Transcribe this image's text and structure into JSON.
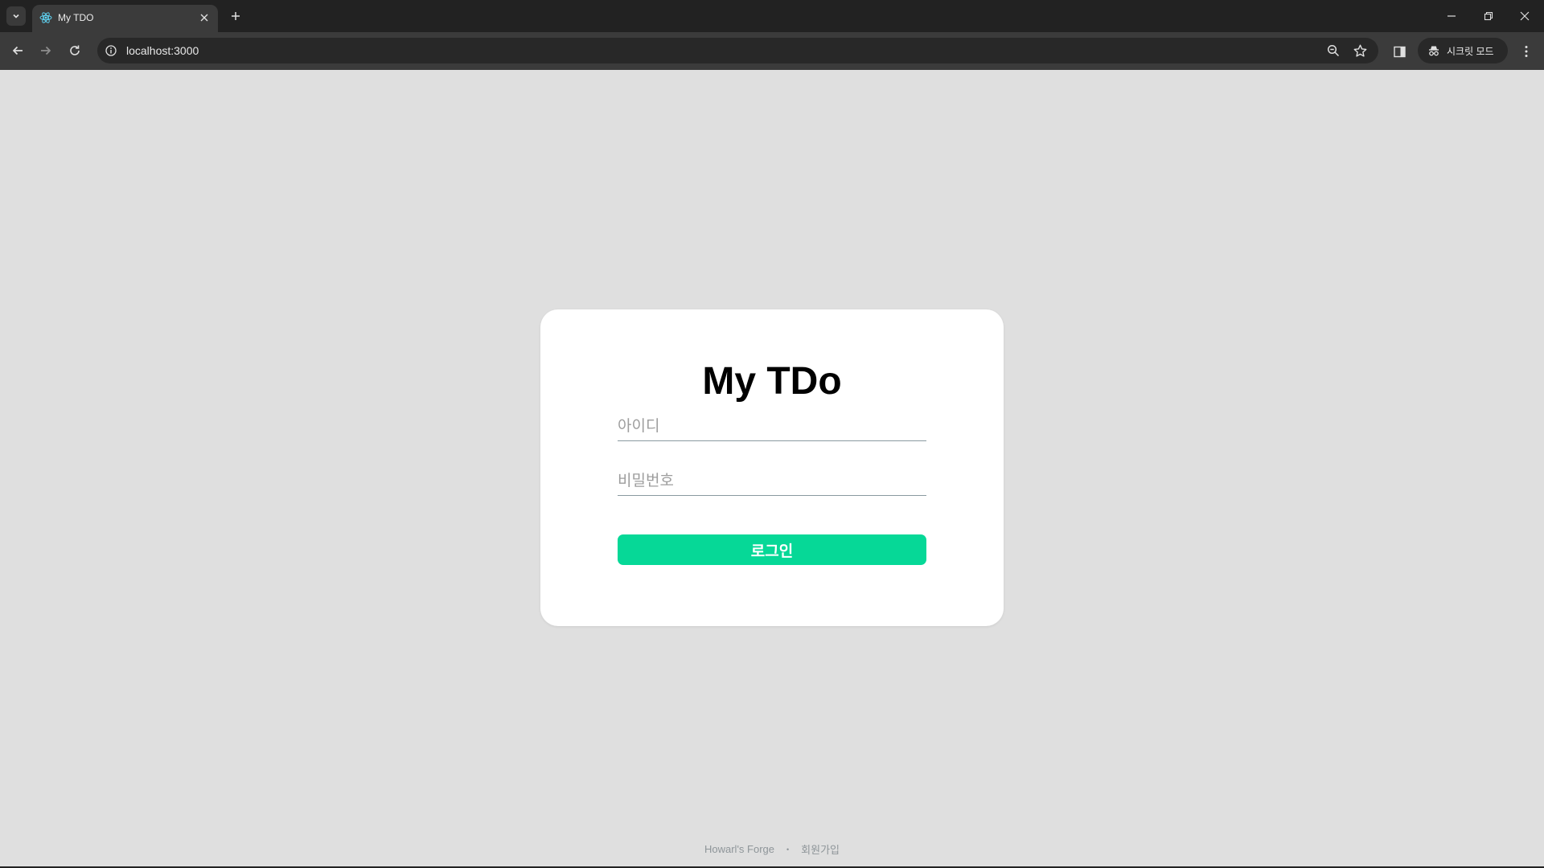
{
  "browser": {
    "tab": {
      "title": "My TDO"
    },
    "url": "localhost:3000",
    "incognito_label": "시크릿 모드"
  },
  "page": {
    "title": "My TDo",
    "id_field": {
      "placeholder": "아이디",
      "value": ""
    },
    "password_field": {
      "placeholder": "비밀번호",
      "value": ""
    },
    "login_label": "로그인",
    "accent_color": "#06d897"
  },
  "footer": {
    "brand": "Howarl's Forge",
    "separator": "•",
    "signup": "회원가입"
  }
}
